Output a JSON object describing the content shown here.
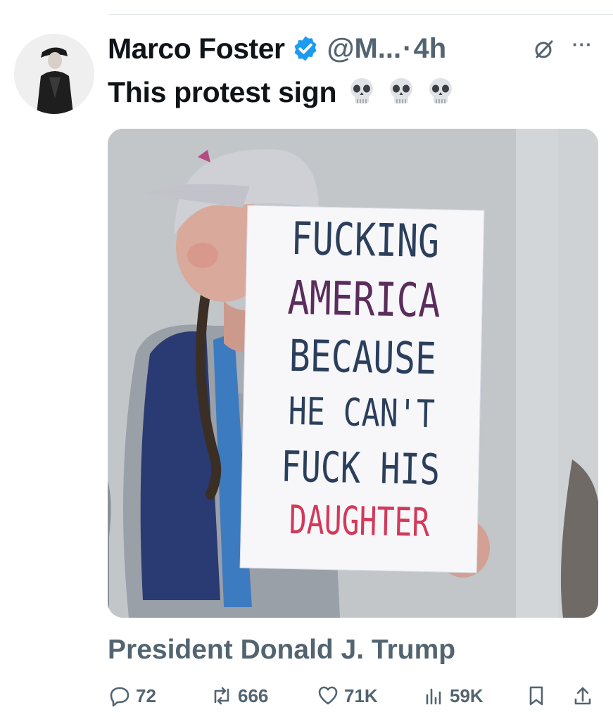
{
  "post": {
    "author": {
      "display_name": "Marco Foster",
      "handle": "@M...",
      "separator": "·",
      "time": "4h",
      "avatar_icon": "avatar-person-jacket",
      "verified_icon": "verified-badge-icon",
      "verified_color": "#1d9bf0"
    },
    "text": "This protest sign",
    "emoji": [
      "skull-emoji",
      "skull-emoji",
      "skull-emoji"
    ],
    "media": {
      "sign_lines": [
        {
          "text": "FUCKING",
          "color": "#2b3f5c"
        },
        {
          "text": "AMERICA",
          "color": "#5a2d5c"
        },
        {
          "text": "BECAUSE",
          "color": "#2b3f5c"
        },
        {
          "text": "HE CAN'T",
          "color": "#2b3f5c"
        },
        {
          "text": "FUCK HIS",
          "color": "#2b3f5c"
        },
        {
          "text": "DAUGHTER",
          "color": "#d23a5a"
        }
      ]
    },
    "quoted_name": "President Donald J. Trump",
    "actions": {
      "replies": "72",
      "reposts": "666",
      "likes": "71K",
      "views": "59K"
    }
  },
  "icons": {
    "grok": "grok-icon",
    "more": "more-icon",
    "more_glyph": "···"
  }
}
